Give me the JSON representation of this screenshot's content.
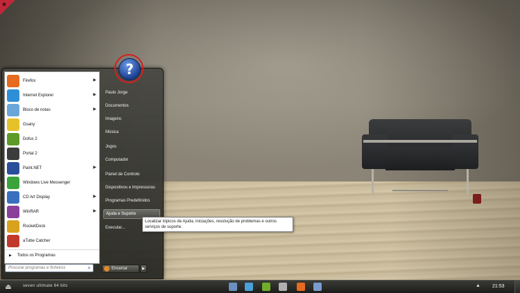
{
  "start_menu": {
    "pinned": [
      {
        "label": "Firefox",
        "icon": "firefox-icon",
        "color": "#e66a1f",
        "arrow": true
      },
      {
        "label": "Internet Explorer",
        "icon": "internet-explorer-icon",
        "color": "#2f8fd6",
        "arrow": true
      },
      {
        "label": "Bloco de notas",
        "icon": "notepad-icon",
        "color": "#6aa7d8",
        "arrow": true
      },
      {
        "label": "Gsany",
        "icon": "gsany-icon",
        "color": "#e5c22a",
        "arrow": false
      },
      {
        "label": "Dofus 2",
        "icon": "dofus-egg-icon",
        "color": "#5d9a2a",
        "arrow": false
      },
      {
        "label": "Portal 2",
        "icon": "portal-icon",
        "color": "#3c3c3c",
        "arrow": false
      },
      {
        "label": "Paint.NET",
        "icon": "paint-net-icon",
        "color": "#2a4f9a",
        "arrow": true
      },
      {
        "label": "Windows Live Messenger",
        "icon": "messenger-icon",
        "color": "#3ba33b",
        "arrow": false
      },
      {
        "label": "CD Art Display",
        "icon": "cd-art-display-icon",
        "color": "#3a6fc0",
        "arrow": true
      },
      {
        "label": "WinRAR",
        "icon": "winrar-icon",
        "color": "#8a3f9a",
        "arrow": true
      },
      {
        "label": "RocketDock",
        "icon": "rocketdock-icon",
        "color": "#d8a21e",
        "arrow": false
      },
      {
        "label": "aTube Catcher",
        "icon": "atube-catcher-icon",
        "color": "#c0392b",
        "arrow": false
      }
    ],
    "all_programs": "Todos os Programas",
    "search_placeholder": "Procurar programas e ficheiros",
    "right_items": [
      {
        "label": "Paulo Jorge"
      },
      {
        "label": "Documentos"
      },
      {
        "label": "Imagens"
      },
      {
        "label": "Música"
      },
      {
        "label": "Jogos"
      },
      {
        "label": "Computador"
      },
      {
        "label": "Painel de Controlo"
      },
      {
        "label": "Dispositivos e Impressoras"
      },
      {
        "label": "Programas Predefinidos"
      },
      {
        "label": "Ajuda e Suporte",
        "highlighted": true
      },
      {
        "label": "Executar..."
      }
    ],
    "shutdown_label": "Encerrar"
  },
  "tooltip": "Localizar tópicos de Ajuda, iniciações, resolução de problemas e outros serviços de suporte.",
  "taskbar": {
    "label": "seven ultimate 64 bits",
    "clock": "21:53",
    "icons": [
      {
        "name": "monitor-icon",
        "color": "#6b8fbf"
      },
      {
        "name": "music-icon",
        "color": "#4aa0d8"
      },
      {
        "name": "nvidia-icon",
        "color": "#6fae2a"
      },
      {
        "name": "tools-icon",
        "color": "#b0b0b0"
      },
      {
        "name": "firefox-icon",
        "color": "#e66a1f"
      },
      {
        "name": "explorer-icon",
        "color": "#7a9bcf"
      }
    ]
  }
}
